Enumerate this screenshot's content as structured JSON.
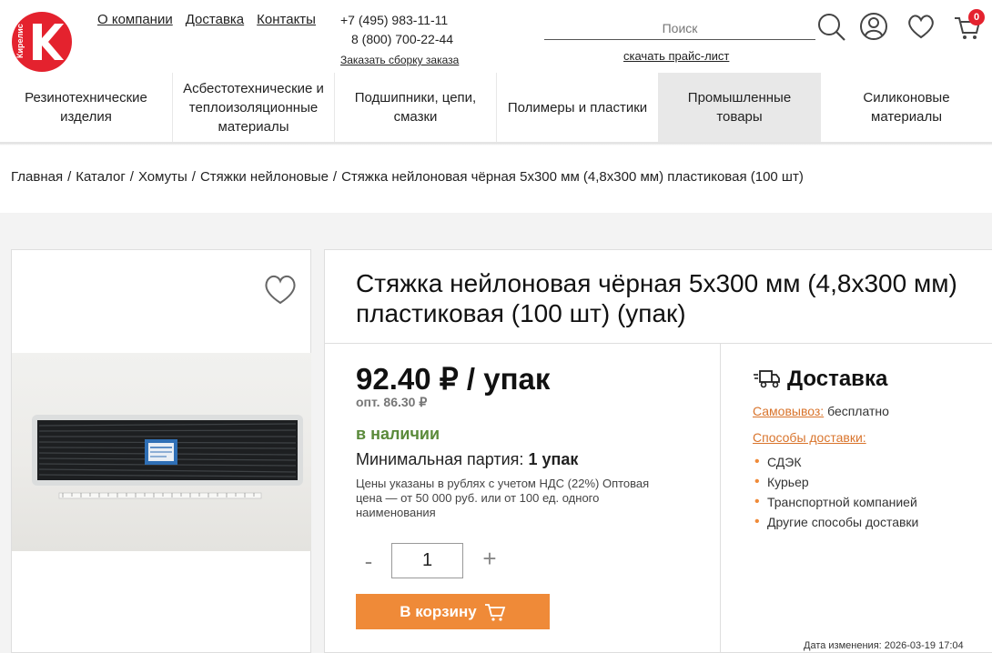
{
  "brand": {
    "logo_text": "Кирелис",
    "accent": "#e4222e"
  },
  "header": {
    "links": [
      "О компании",
      "Доставка",
      "Контакты"
    ],
    "phone1": "+7 (495) 983-11-11",
    "phone2": "8 (800) 700-22-44",
    "order_link": "Заказать сборку заказа",
    "search_placeholder": "Поиск",
    "price_list": "скачать прайс-лист",
    "cart_count": "0"
  },
  "categories": [
    {
      "label": "Резинотехнические изделия",
      "active": false
    },
    {
      "label": "Асбестотехнические и теплоизоляционные материалы",
      "active": false
    },
    {
      "label": "Подшипники, цепи, смазки",
      "active": false
    },
    {
      "label": "Полимеры и пластики",
      "active": false
    },
    {
      "label": "Промышленные товары",
      "active": true
    },
    {
      "label": "Силиконовые материалы",
      "active": false
    }
  ],
  "breadcrumb": {
    "items": [
      "Главная",
      "Каталог",
      "Хомуты",
      "Стяжки нейлоновые"
    ],
    "current": "Стяжка нейлоновая чёрная 5x300 мм (4,8x300 мм) пластиковая (100 шт)"
  },
  "product": {
    "title": "Стяжка нейлоновая чёрная 5x300 мм (4,8x300 мм) пластиковая (100 шт) (упак)",
    "price": "92.40 ₽ / упак",
    "price_opt": "опт. 86.30 ₽",
    "stock": "в наличии",
    "min_batch_label": "Минимальная партия:",
    "min_batch_value": "1 упак",
    "note": "Цены указаны в рублях с учетом НДС (22%) Оптовая цена — от 50 000 руб. или от 100 ед. одного наименования",
    "qty_minus": "-",
    "qty_value": "1",
    "qty_plus": "+",
    "cart_button": "В корзину",
    "updated": "Дата изменения: 2026-03-19 17:04"
  },
  "delivery": {
    "heading": "Доставка",
    "pickup_label": "Самовывоз:",
    "pickup_value": "бесплатно",
    "methods_label": "Способы доставки:",
    "methods": [
      "СДЭК",
      "Курьер",
      "Транспортной компанией",
      "Другие способы доставки"
    ]
  }
}
